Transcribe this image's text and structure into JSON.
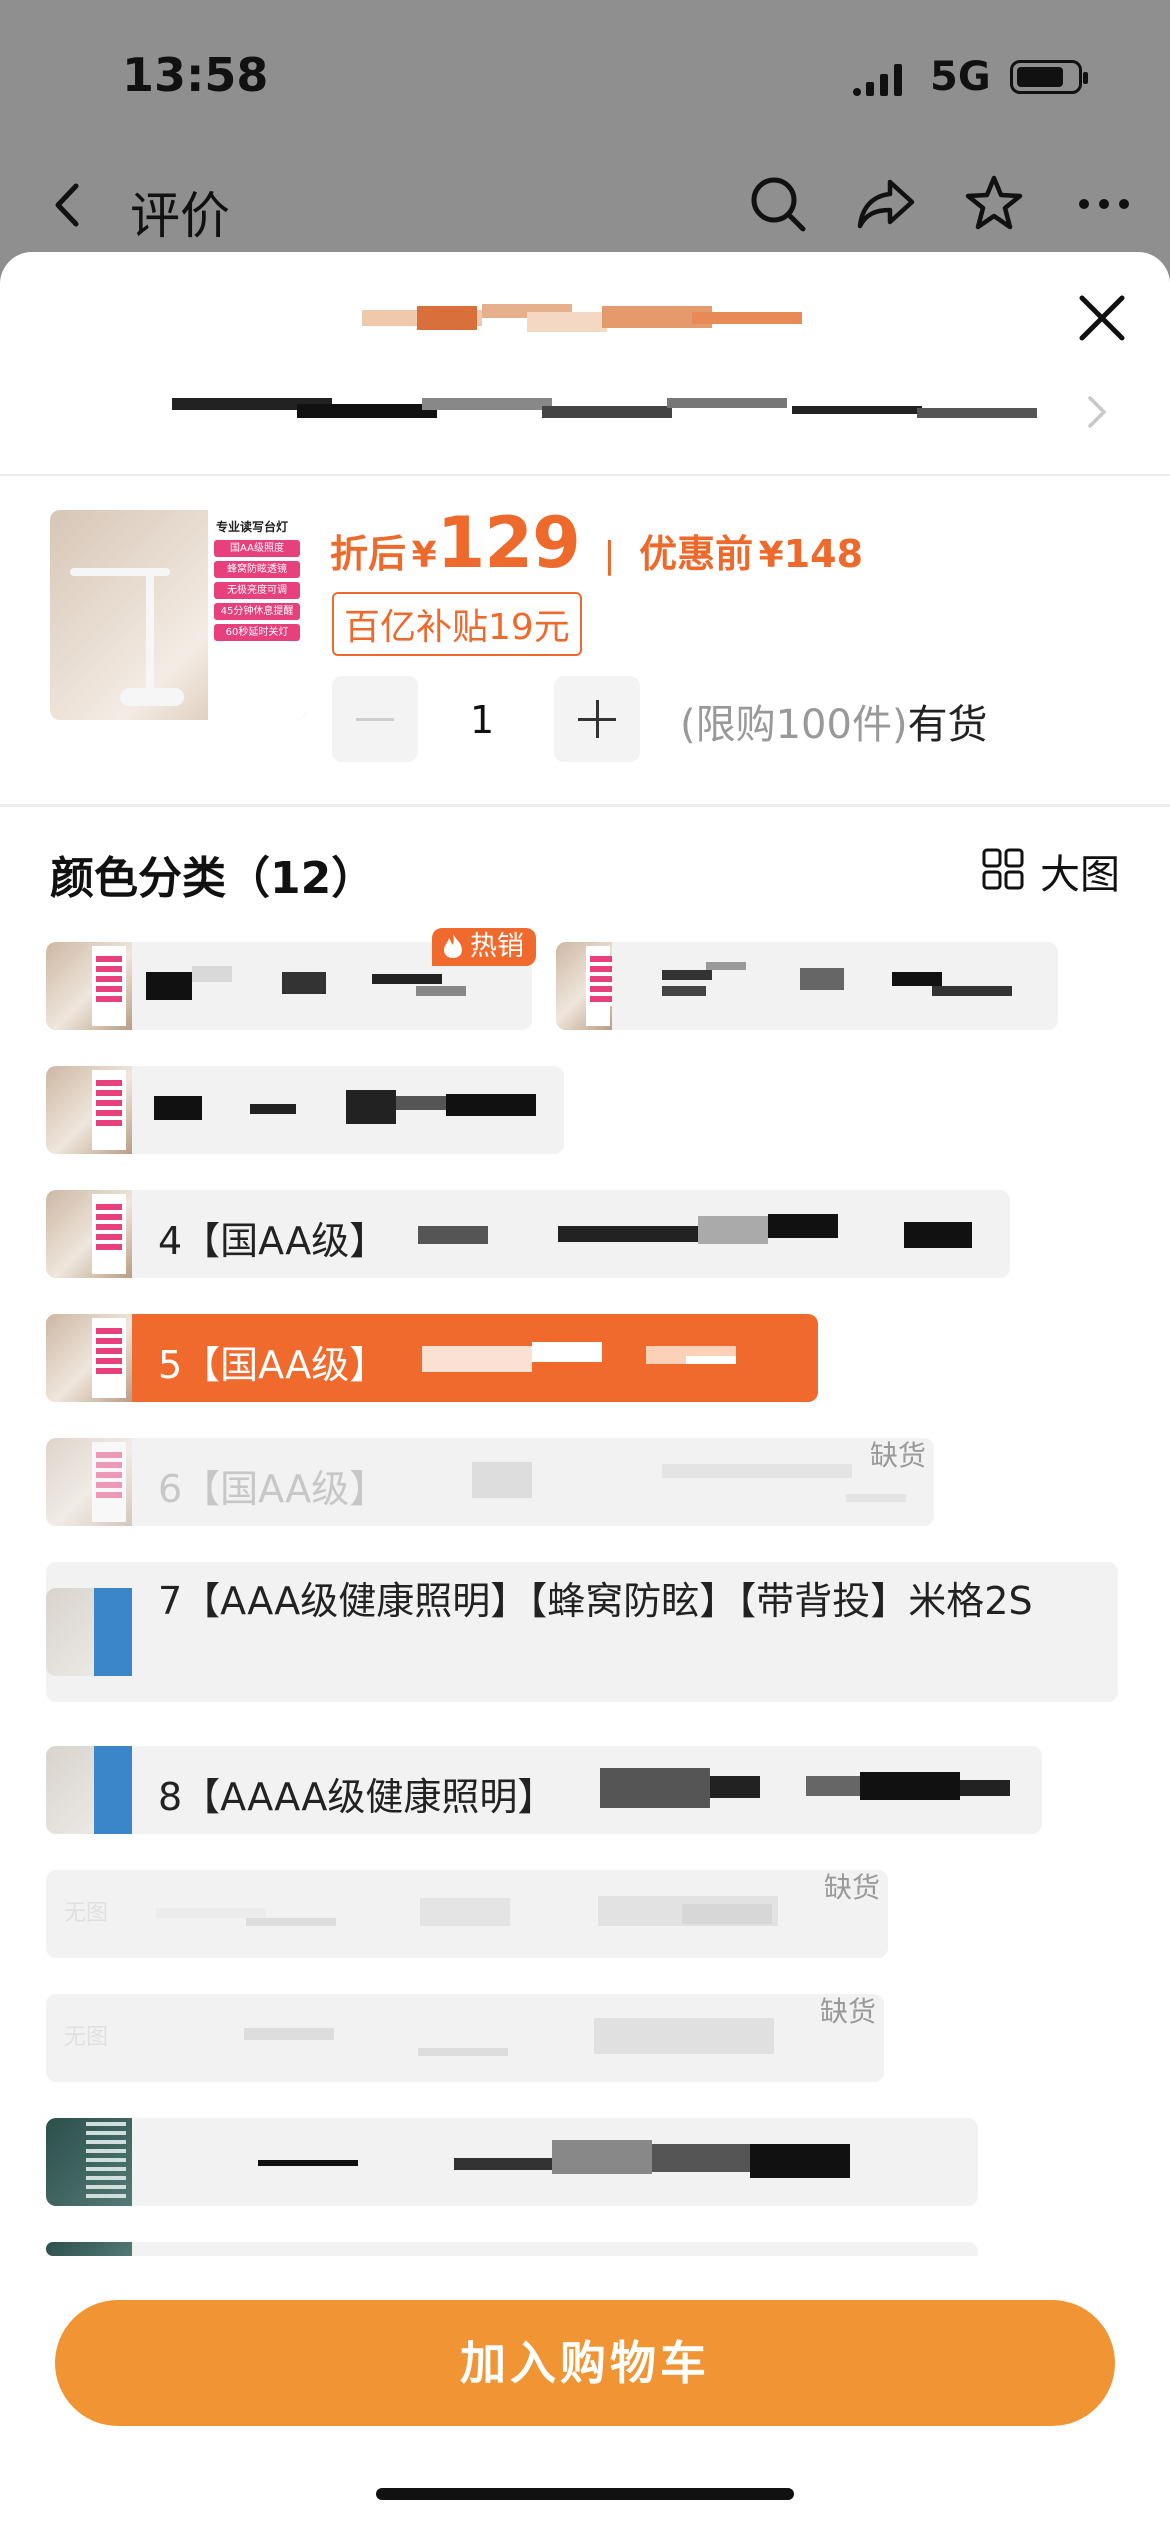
{
  "status_bar": {
    "time": "13:58",
    "network": "5G"
  },
  "nav": {
    "title": "评价"
  },
  "product": {
    "price_after_label": "折后",
    "currency": "¥",
    "price_after": "129",
    "separator": "|",
    "price_before_label": "优惠前",
    "price_before": "148",
    "subsidy": "百亿补贴19元",
    "thumb_title": "专业读写台灯",
    "thumb_tags": [
      "国AA级照度",
      "蜂窝防眩透镜",
      "无极亮度可调",
      "45分钟休息提醒",
      "60秒延时关灯"
    ]
  },
  "quantity": {
    "value": "1",
    "limit_text": "(限购100件)",
    "stock_text": "有货"
  },
  "options_section": {
    "title": "颜色分类（12）",
    "big_view": "大图"
  },
  "options": [
    {
      "label": "",
      "badge": "热销"
    },
    {
      "label": ""
    },
    {
      "label": ""
    },
    {
      "label": "4【国AA级】"
    },
    {
      "label": "5【国AA级】",
      "selected": true
    },
    {
      "label": "6【国AA级】",
      "status": "缺货"
    },
    {
      "label": "7【AAA级健康照明】【蜂窝防眩】【带背投】米格2S"
    },
    {
      "label": "8【AAAA级健康照明】"
    },
    {
      "label": "",
      "no_image": "无图",
      "status": "缺货"
    },
    {
      "label": "",
      "no_image": "无图",
      "status": "缺货"
    },
    {
      "label": ""
    }
  ],
  "cart_button": "加入购物车",
  "colors": {
    "accent": "#ED6A2C",
    "cart": "#F19433",
    "chip_bg": "#F2F2F2"
  }
}
